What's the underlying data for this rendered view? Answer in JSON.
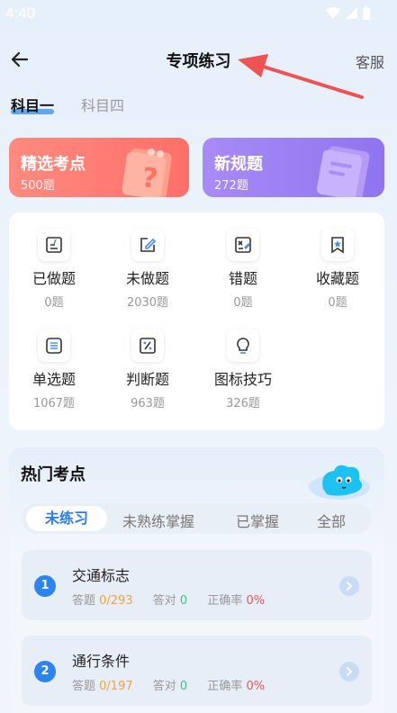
{
  "status_bar": {
    "time": "4:40"
  },
  "nav": {
    "title": "专项练习",
    "service": "客服"
  },
  "subject_tabs": [
    {
      "label": "科目一",
      "active": true
    },
    {
      "label": "科目四",
      "active": false
    }
  ],
  "cards": [
    {
      "title": "精选考点",
      "count": "500题",
      "color": "#ff7a72"
    },
    {
      "title": "新规题",
      "count": "272题",
      "color": "#9a7ff3"
    }
  ],
  "grid": [
    {
      "label": "已做题",
      "count": "0题",
      "icon": "edit-list-icon"
    },
    {
      "label": "未做题",
      "count": "2030题",
      "icon": "pencil-icon"
    },
    {
      "label": "错题",
      "count": "0题",
      "icon": "error-note-icon"
    },
    {
      "label": "收藏题",
      "count": "0题",
      "icon": "bookmark-star-icon"
    },
    {
      "label": "单选题",
      "count": "1067题",
      "icon": "list-icon"
    },
    {
      "label": "判断题",
      "count": "963题",
      "icon": "percent-icon"
    },
    {
      "label": "图标技巧",
      "count": "326题",
      "icon": "bulb-icon"
    }
  ],
  "hot": {
    "title": "热门考点",
    "filters": [
      {
        "label": "未练习",
        "active": true
      },
      {
        "label": "未熟练掌握",
        "active": false
      },
      {
        "label": "已掌握",
        "active": false
      },
      {
        "label": "全部",
        "active": false
      }
    ],
    "topics": [
      {
        "num": "1",
        "name": "交通标志",
        "answered_label": "答题",
        "answered": "0/293",
        "correct_label": "答对",
        "correct": "0",
        "rate_label": "正确率",
        "rate": "0%"
      },
      {
        "num": "2",
        "name": "通行条件",
        "answered_label": "答题",
        "answered": "0/197",
        "correct_label": "答对",
        "correct": "0",
        "rate_label": "正确率",
        "rate": "0%"
      }
    ]
  },
  "colors": {
    "accent": "#2c84ee",
    "red_card": "#ff7a72",
    "purple_card": "#9a7ff3",
    "annotation_arrow": "#ee5353"
  }
}
